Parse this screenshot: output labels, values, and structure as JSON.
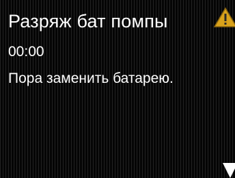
{
  "alert": {
    "title": "Разряж бат помпы",
    "time": "00:00",
    "message": "Пора заменить батарею."
  },
  "icons": {
    "warning": "warning-triangle-icon",
    "scroll": "scroll-down-arrow-icon"
  },
  "colors": {
    "background": "#050505",
    "text": "#ffffff",
    "warning_fill": "#d9a21b"
  }
}
